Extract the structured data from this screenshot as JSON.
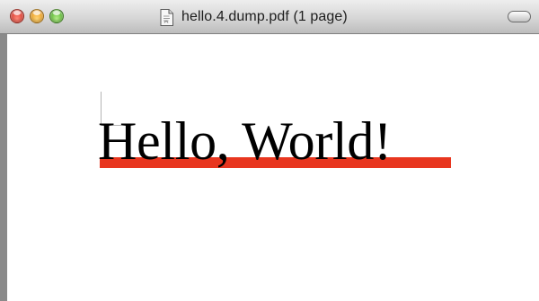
{
  "window": {
    "title": "hello.4.dump.pdf (1 page)"
  },
  "document": {
    "text": "Hello, World!"
  },
  "colors": {
    "underline": "#e8361f",
    "window_chrome": "#8a8a8a"
  },
  "icons": {
    "document": "pdf-document-icon",
    "toolbar_toggle": "toolbar-toggle-icon"
  }
}
